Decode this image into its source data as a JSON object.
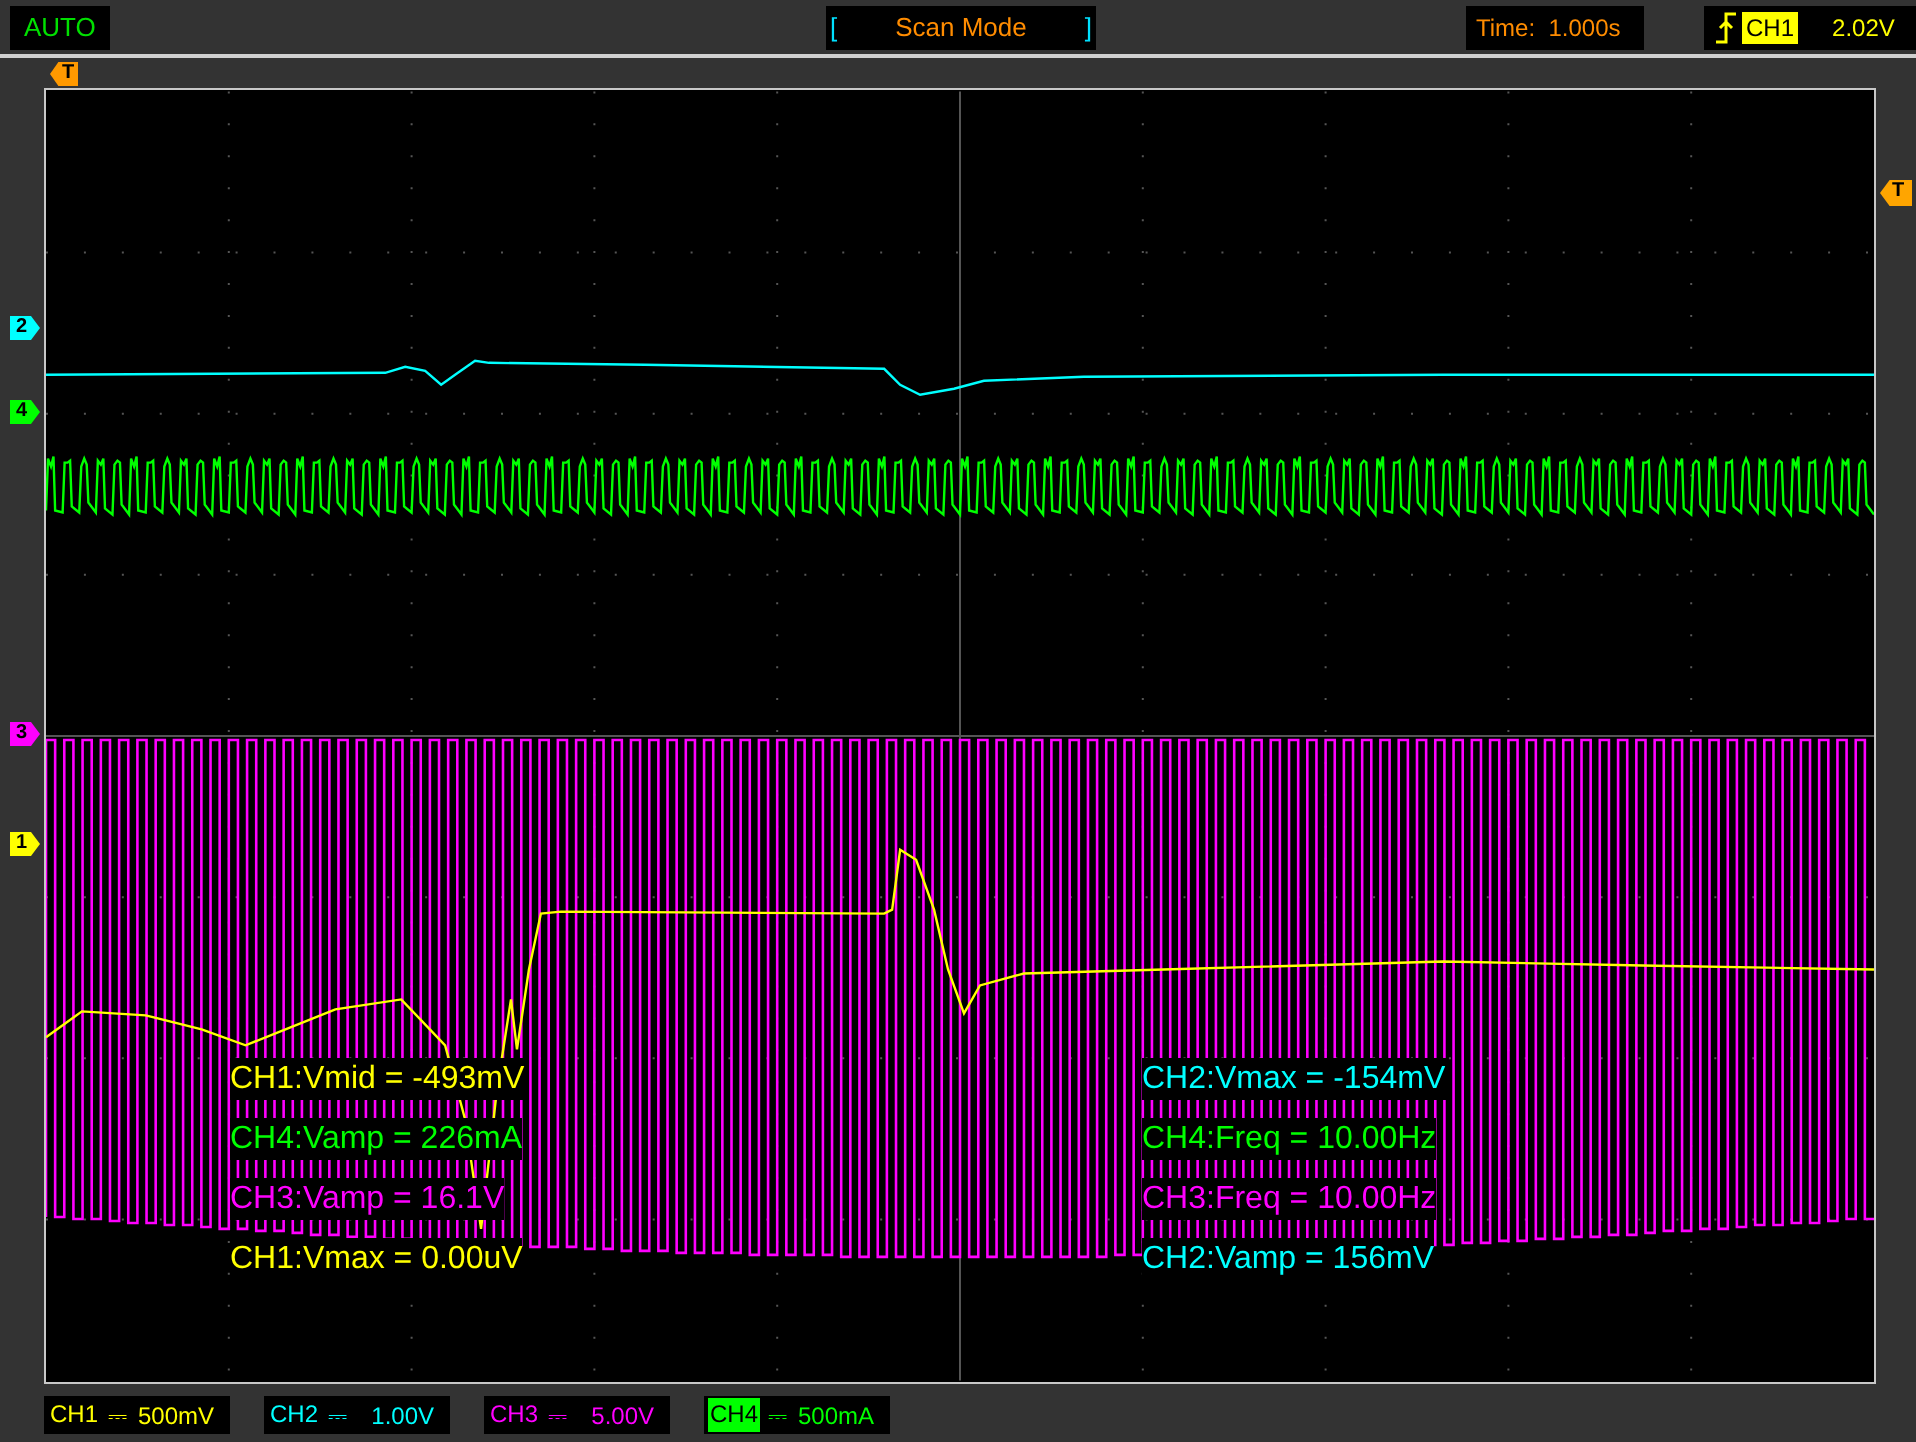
{
  "top_bar": {
    "acquire_mode": "AUTO",
    "scan_brackets": [
      "[",
      "]"
    ],
    "scan_mode": "Scan Mode",
    "time": "Time:  1.000s",
    "trigger_channel": "CH1",
    "trigger_level": "2.02V"
  },
  "time_trigger_marker": {
    "label": "T"
  },
  "level_trigger_marker": {
    "label": "T"
  },
  "channel_markers": [
    {
      "label": "2",
      "color": "#00ffff"
    },
    {
      "label": "4",
      "color": "#00ff00"
    },
    {
      "label": "3",
      "color": "#ff00ff"
    },
    {
      "label": "1",
      "color": "#ffff00"
    }
  ],
  "measurements_left": [
    {
      "text": "CH1:Vmid = -493mV",
      "color": "#ffff00"
    },
    {
      "text": "CH4:Vamp = 226mA",
      "color": "#00ff00"
    },
    {
      "text": "CH3:Vamp = 16.1V",
      "color": "#ff00ff"
    },
    {
      "text": "CH1:Vmax = 0.00uV",
      "color": "#ffff00"
    }
  ],
  "measurements_right": [
    {
      "text": "CH2:Vmax = -154mV",
      "color": "#00ffff"
    },
    {
      "text": "CH4:Freq = 10.00Hz",
      "color": "#00ff00"
    },
    {
      "text": "CH3:Freq = 10.00Hz",
      "color": "#ff00ff"
    },
    {
      "text": "CH2:Vamp = 156mV",
      "color": "#00ffff"
    }
  ],
  "channels": [
    {
      "label": "CH1",
      "coupling": "⎓",
      "scale": "500mV",
      "color": "#ffff00",
      "selected": false
    },
    {
      "label": "CH2",
      "coupling": "⎓",
      "scale": "1.00V",
      "color": "#00ffff",
      "selected": false
    },
    {
      "label": "CH3",
      "coupling": "⎓",
      "scale": "5.00V",
      "color": "#ff00ff",
      "selected": false
    },
    {
      "label": "CH4",
      "coupling": "⎓",
      "scale": "500mA",
      "color": "#00ff00",
      "selected": true
    }
  ]
}
